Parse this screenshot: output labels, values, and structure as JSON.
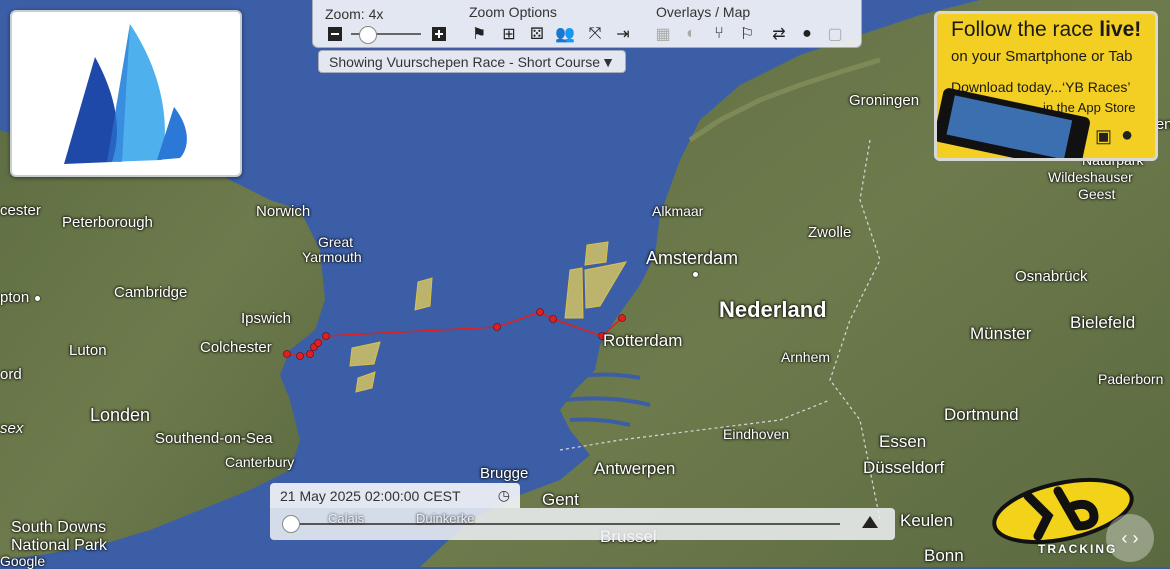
{
  "toolbar": {
    "zoom_label": "Zoom: 4x",
    "zoom_options_label": "Zoom Options",
    "overlays_label": "Overlays / Map"
  },
  "race_selector": {
    "label": "Showing Vuurschepen Race - Short Course"
  },
  "promo": {
    "line1_prefix": "Follow the race ",
    "line1_emphasis": "live!",
    "line2": "on your Smartphone or Tab",
    "line3": "Download today...‘YB Races’",
    "line4": "in the App Store"
  },
  "timeline": {
    "datetime": "21 May 2025 02:00:00 CEST",
    "progress": 0
  },
  "map_labels": {
    "groningen": "Groningen",
    "bremen": "Bremen",
    "naturpark": "Naturpark",
    "wildeshauser": "Wildeshauser",
    "geest": "Geest",
    "leicester": "cester",
    "peterborough": "Peterborough",
    "norwich": "Norwich",
    "great": "Great",
    "yarmouth": "Yarmouth",
    "alkmaar": "Alkmaar",
    "zwolle": "Zwolle",
    "amsterdam": "Amsterdam",
    "osnabruck": "Osnabrück",
    "northampton": "pton",
    "cambridge": "Cambridge",
    "nederland": "Nederland",
    "ipswich": "Ipswich",
    "munster": "Münster",
    "bielefeld": "Bielefeld",
    "colchester": "Colchester",
    "rotterdam": "Rotterdam",
    "luton": "Luton",
    "arnhem": "Arnhem",
    "oxford": "ord",
    "paderborn": "Paderborn",
    "londen": "Londen",
    "dortmund": "Dortmund",
    "essex": "sex",
    "southend": "Southend-on-Sea",
    "eindhoven": "Eindhoven",
    "essen": "Essen",
    "canterbury": "Canterbury",
    "antwerpen": "Antwerpen",
    "dusseldorf": "Düsseldorf",
    "brugge": "Brugge",
    "gent": "Gent",
    "calais": "Calais",
    "duinkerke": "Duinkerke",
    "south_downs_1": "South Downs",
    "south_downs_2": "National Park",
    "brussel": "Brussel",
    "keulen": "Keulen",
    "bonn": "Bonn",
    "google": "Google"
  },
  "tracking_brand": "TRACKING",
  "colors": {
    "sea": "#3b5ea6",
    "track": "#e02020",
    "zone_fill": "#e8d25a",
    "promo_bg": "#f2cf22",
    "logo_dark": "#1f49a8",
    "logo_mid": "#2b78d6",
    "logo_light": "#4fb0ee"
  },
  "icons": [
    "zoom-out-icon",
    "zoom-in-icon",
    "flag-icon",
    "plus-box-icon",
    "dice-icon",
    "group-icon",
    "expand-icon",
    "exit-icon",
    "grid-icon",
    "contrast-icon",
    "path-icon",
    "wind-flag-icon",
    "shuffle-icon",
    "globe-icon",
    "square-icon"
  ]
}
